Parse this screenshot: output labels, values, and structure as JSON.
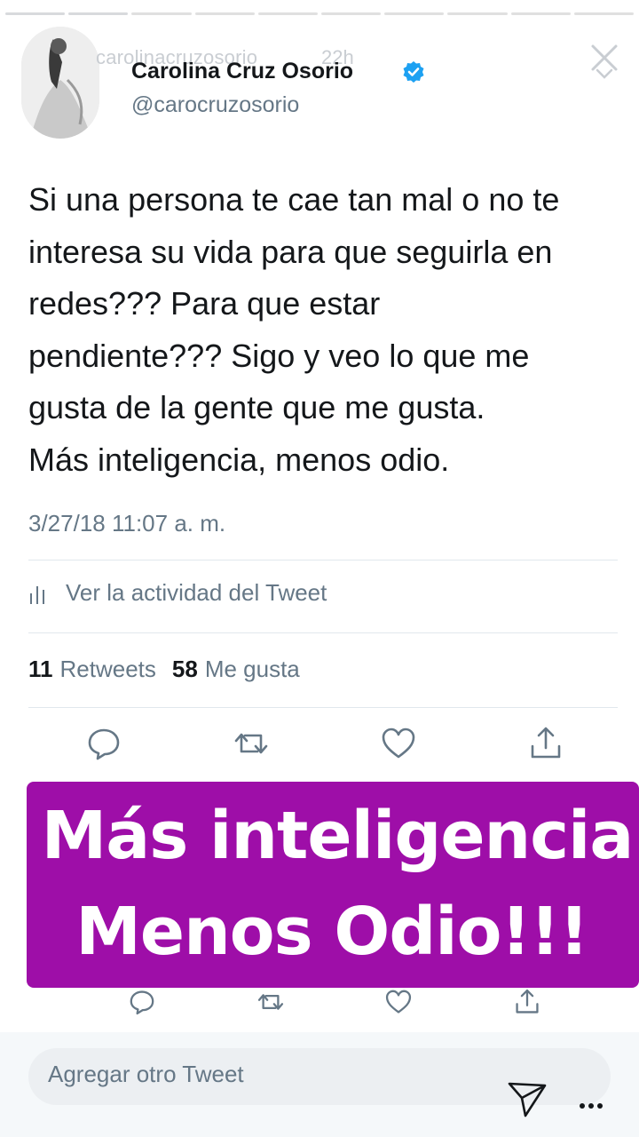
{
  "colors": {
    "text": "#14171a",
    "secondary": "#657786",
    "divider": "#e1e8ed",
    "verified": "#1da1f2",
    "overlay": "#9e0ea8",
    "overlay_text": "#ffffff"
  },
  "story": {
    "username": "carolinacruzosorio",
    "time": "22h",
    "progress_segments": 10,
    "progress_done": 2
  },
  "tweet": {
    "author_name": "Carolina Cruz Osorio",
    "author_handle": "@carocruzosorio",
    "text": "Si una persona te cae tan mal o no te\ninteresa su vida para que seguirla en\nredes??? Para que estar\npendiente??? Sigo y veo lo que me\ngusta de la gente que me gusta.\nMás inteligencia, menos odio.",
    "date": "3/27/18 11:07 a. m.",
    "activity_label": "Ver la actividad del Tweet",
    "retweets_count": "11",
    "retweets_label": "Retweets",
    "likes_count": "58",
    "likes_label": "Me gusta"
  },
  "overlay": {
    "line1": "Más inteligencia",
    "line2": "Menos Odio!!!"
  },
  "compose": {
    "placeholder": "Agregar otro Tweet"
  },
  "icons": {
    "reply": "reply-icon",
    "retweet": "retweet-icon",
    "like": "heart-icon",
    "share": "share-icon",
    "close": "close-icon",
    "send": "send-icon",
    "more": "more-icon",
    "verified": "verified-badge-icon",
    "activity": "bar-chart-icon"
  }
}
